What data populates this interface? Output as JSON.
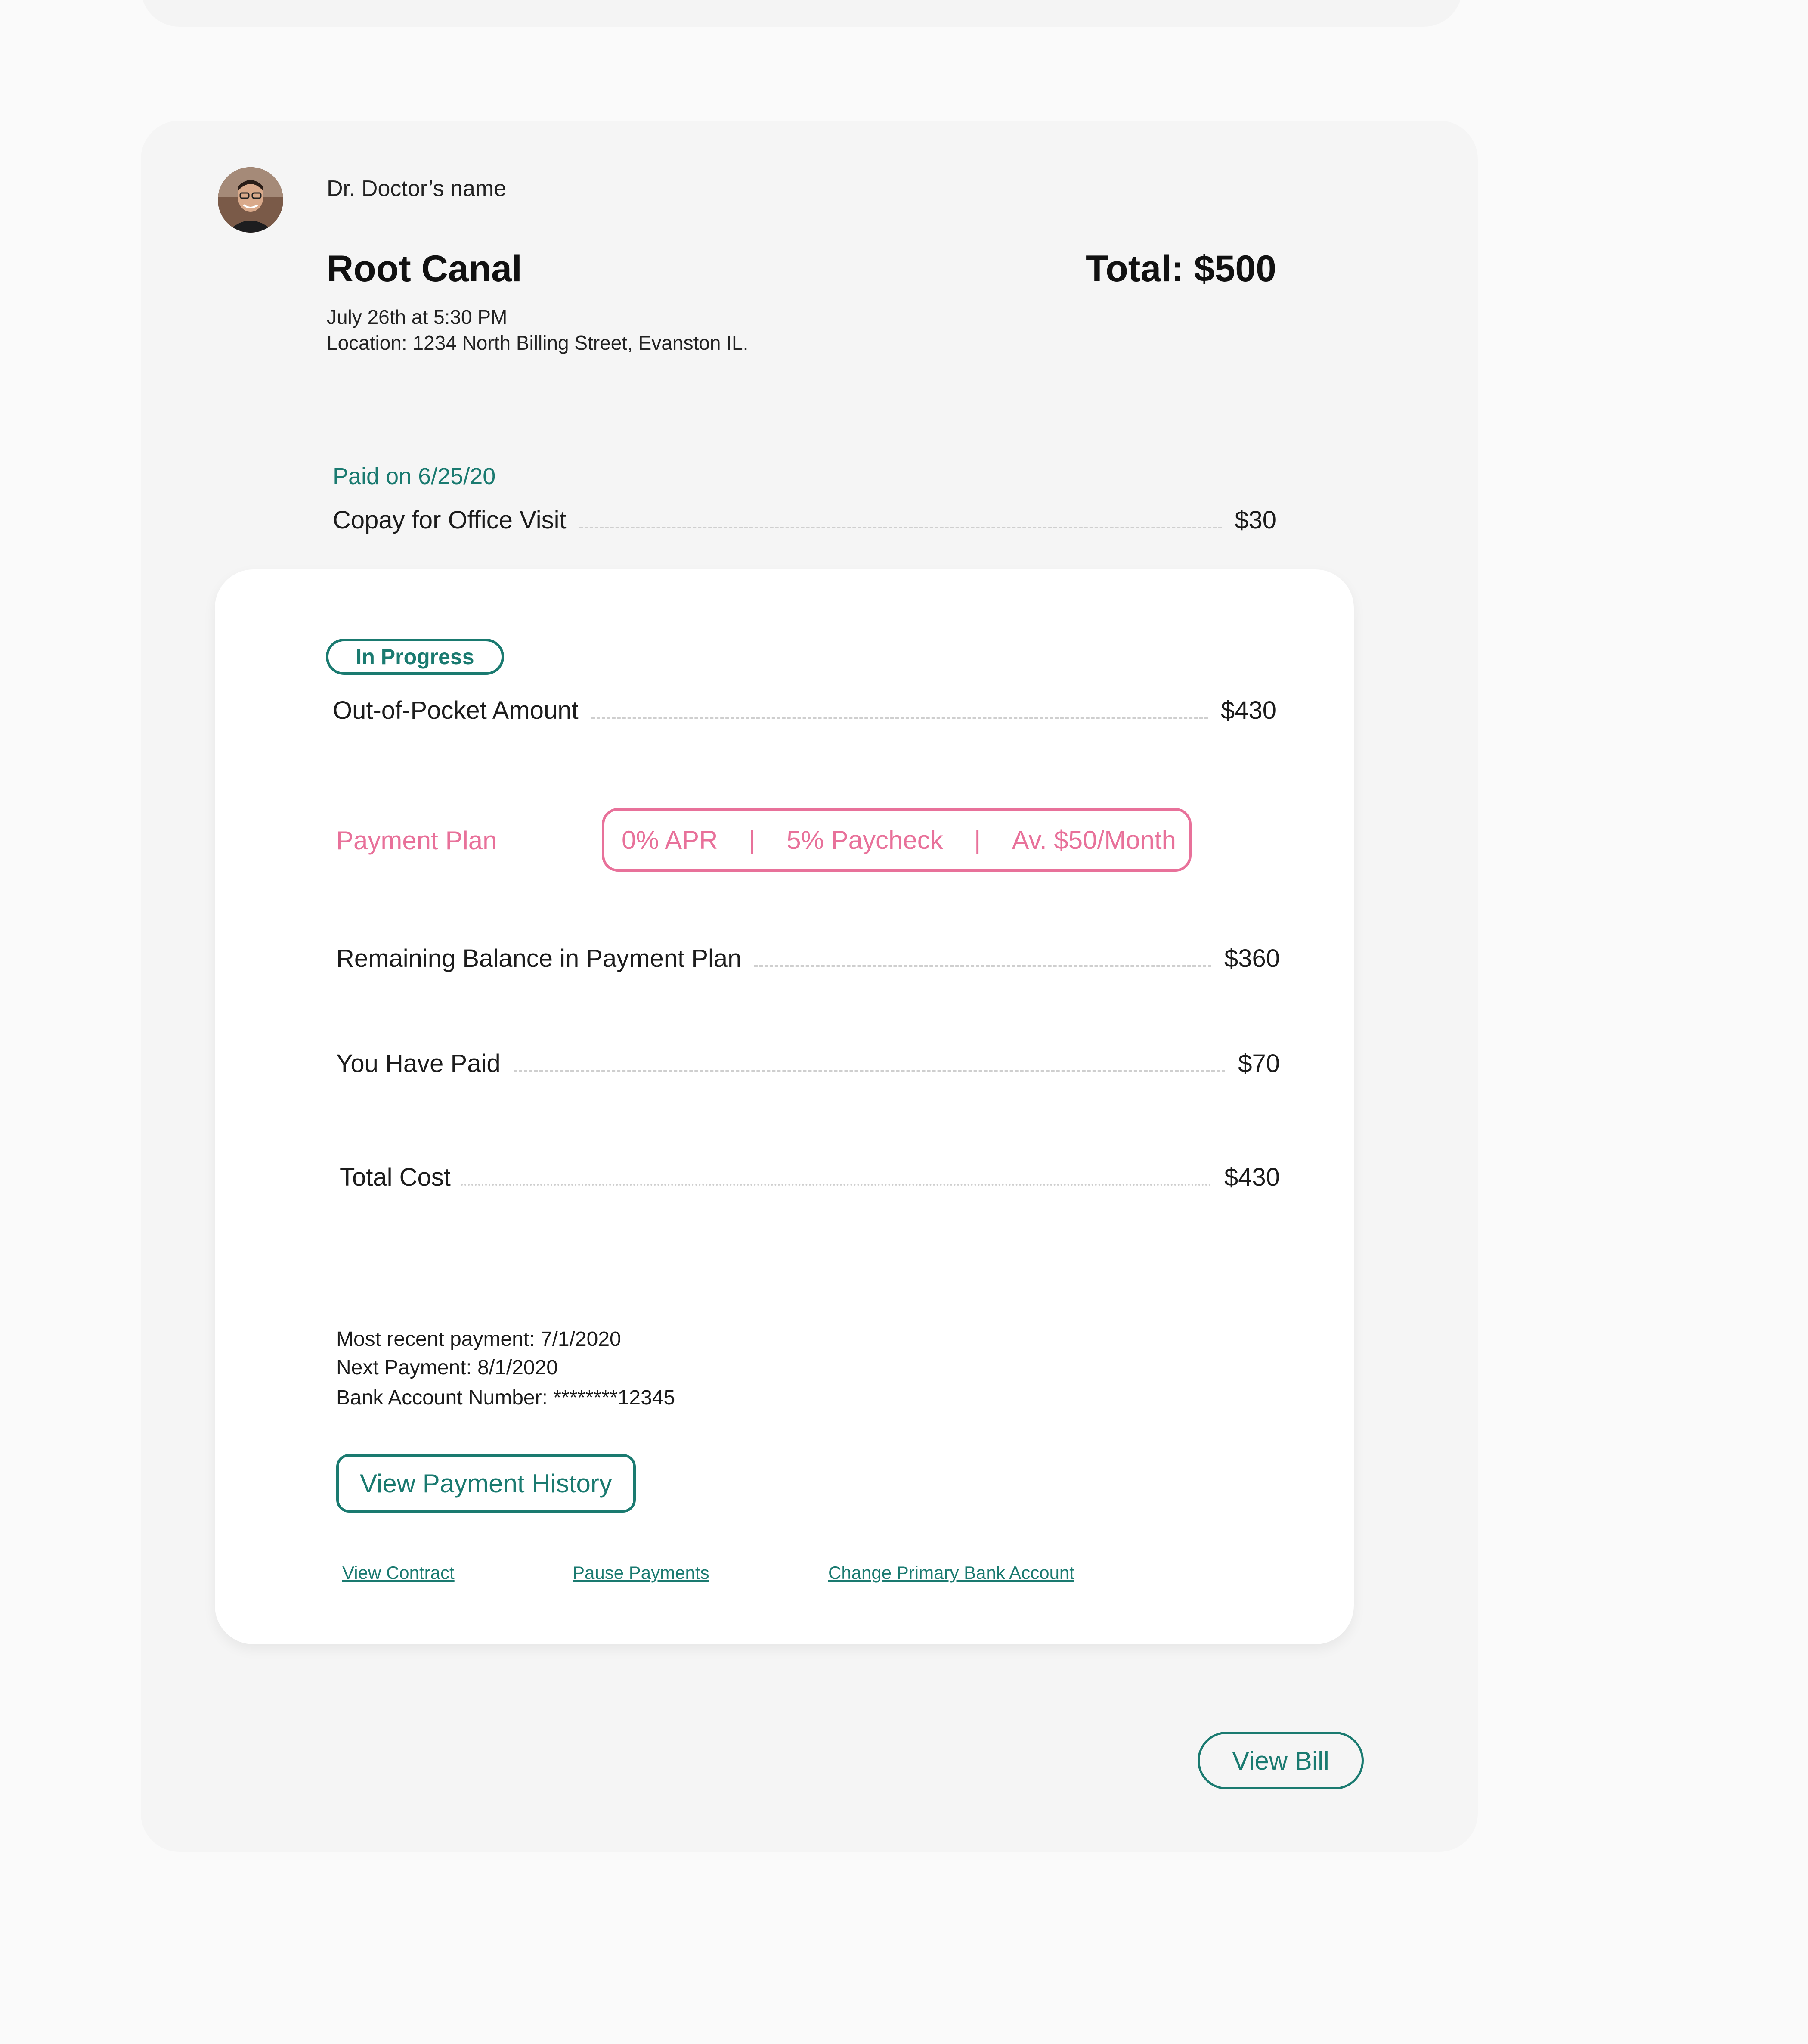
{
  "doctor": {
    "name": "Dr. Doctor’s name"
  },
  "procedure": {
    "title": "Root Canal",
    "total": "Total: $500",
    "date": "July 26th at 5:30 PM",
    "location": "Location: 1234 North Billing Street, Evanston IL."
  },
  "copay": {
    "paid_on": "Paid on 6/25/20",
    "label": "Copay for Office Visit",
    "value": "$30"
  },
  "plan": {
    "status": "In Progress",
    "out_of_pocket_label": "Out-of-Pocket Amount",
    "out_of_pocket_value": "$430",
    "payment_plan_label": "Payment Plan",
    "terms": {
      "apr": "0% APR",
      "paycheck": "5% Paycheck",
      "monthly": "Av. $50/Month",
      "separator": "|"
    },
    "remaining_label": "Remaining Balance in Payment Plan",
    "remaining_value": "$360",
    "paid_label": "You Have Paid",
    "paid_value": "$70",
    "total_cost_label": "Total Cost",
    "total_cost_value": "$430",
    "most_recent_payment": "Most recent payment: 7/1/2020",
    "next_payment": "Next Payment: 8/1/2020",
    "bank_account": "Bank Account Number: ********12345",
    "history_button": "View Payment History",
    "links": {
      "contract": "View Contract",
      "pause": "Pause Payments",
      "change_bank": "Change Primary Bank Account"
    }
  },
  "actions": {
    "view_bill": "View Bill"
  },
  "colors": {
    "accent_teal": "#1a7a70",
    "accent_pink": "#e8719a",
    "card_gray": "#f5f5f5",
    "inner_card": "#ffffff"
  },
  "icons": {
    "avatar": "doctor-avatar-photo"
  }
}
